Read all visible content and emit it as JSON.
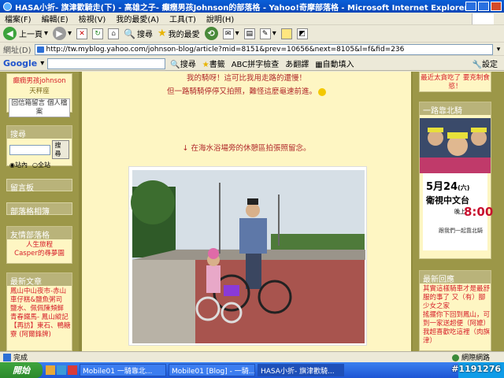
{
  "window": {
    "title": "HASA小折- 旗津歡騎走(下) - 高雄之子- 癲癇男孩Johnson的部落格 - Yahoo!奇摩部落格 - Microsoft Internet Explorer"
  },
  "menu": [
    "檔案(F)",
    "編輯(E)",
    "檢視(V)",
    "我的最愛(A)",
    "工具(T)",
    "說明(H)"
  ],
  "toolbar": {
    "back": "上一頁",
    "search": "搜尋",
    "favorites": "我的最愛"
  },
  "address": {
    "label": "網址(D)",
    "url": "http://tw.myblog.yahoo.com/johnson-blog/article?mid=8151&prev=10656&next=8105&l=f&fid=236"
  },
  "google": {
    "logo": "Google",
    "search": "搜尋",
    "bookmarks": "書籤",
    "spellcheck": "拼字檢查",
    "translate": "翻譯",
    "autofill": "自動填入",
    "settings": "設定"
  },
  "left": {
    "top_links": [
      "癲癇男孩johnson",
      "天秤座",
      "回信箱留言 個人檔案"
    ],
    "search_title": "搜尋",
    "search_button": "搜尋",
    "radio_site": "站內",
    "radio_all": "全站",
    "guestbook": "留言板",
    "albums": "部落格相簿",
    "friends_title": "友情部落格",
    "friends": [
      "人生旅程",
      "Casper的尋夢園"
    ],
    "recent_title": "最新文章",
    "recent": [
      "鳳山中山夜市-赤山車仔糕&鹽魚粥司",
      "鹽水、佩佩陳頻鮮",
      "青春鐵馬- 鳳山縱記",
      "【再訪】東石、鴨糖寮 (阿爾鋒牌)"
    ]
  },
  "center": {
    "line1": "我的騎呀！這可比我用走路的還慢！",
    "line2": "但一路騎騎停停又拍照，難怪這麼龜速前進。",
    "line3": "↓ 在海水浴場旁的休憩區拍張照留念。"
  },
  "right": {
    "top_text": "最近太貪吃了 要克制食慾！",
    "bike_title": "一路靠北騎",
    "ad_date": "5月24",
    "ad_day": "(六)",
    "ad_place": "衛視中文台",
    "ad_time_label": "晚上",
    "ad_time": "8:00",
    "ad_tagline": "跟我們一起靠北騎",
    "replies_title": "最新回應",
    "replies": [
      "其實這樣騎車才是最舒服的事了 又（有）腳少女之家",
      "搖擺你下回到鳳山，可到一家送超便（阿嬤）",
      "我超喜歡吃這裡（肉旗津）"
    ]
  },
  "status": {
    "done": "完成",
    "zone": "網際網路"
  },
  "taskbar": {
    "start": "開始",
    "tasks": [
      "Mobile01 一騎靠北...",
      "Mobile01 [Blog] - 一騎...",
      "HASA小折- 旗津歡騎..."
    ],
    "clock": "#1191276"
  }
}
